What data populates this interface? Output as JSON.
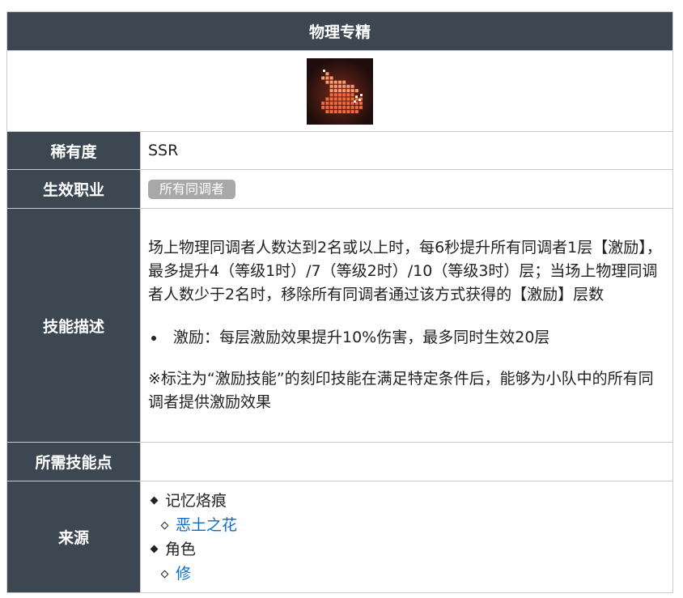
{
  "title": "物理专精",
  "icon": {
    "name": "physical-mastery-icon",
    "bg_color": "#2a1512",
    "accent_color": "#f06a3a"
  },
  "rows": {
    "rarity": {
      "label": "稀有度",
      "value": "SSR"
    },
    "class": {
      "label": "生效职业",
      "tag": "所有同调者"
    },
    "description": {
      "label": "技能描述",
      "text": "场上物理同调者人数达到2名或以上时，每6秒提升所有同调者1层【激励】，最多提升4（等级1时）/7（等级2时）/10（等级3时）层；当场上物理同调者人数少于2名时，移除所有同调者通过该方式获得的【激励】层数",
      "bullet": "激励：每层激励效果提升10%伤害，最多同时生效20层",
      "note": "※标注为“激励技能”的刻印技能在满足特定条件后，能够为小队中的所有同调者提供激励效果"
    },
    "points": {
      "label": "所需技能点",
      "value": ""
    },
    "source": {
      "label": "来源",
      "groups": [
        {
          "name": "记忆烙痕",
          "items": [
            "恶土之花"
          ]
        },
        {
          "name": "角色",
          "items": [
            "修"
          ]
        }
      ]
    }
  },
  "colors": {
    "header_bg": "#3c4751",
    "link": "#0b6bc7",
    "tag_bg": "#a8a8a8"
  }
}
